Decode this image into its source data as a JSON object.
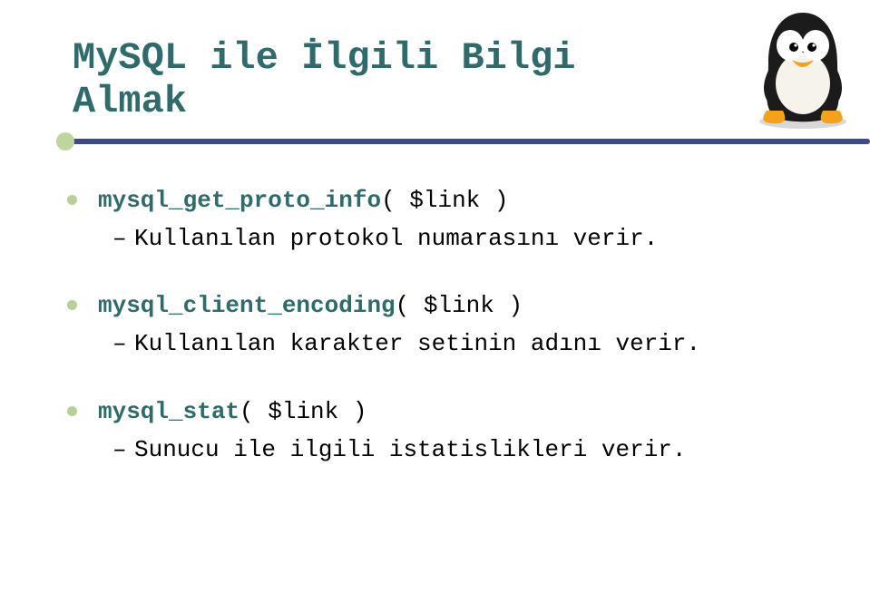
{
  "title_line1": "MySQL ile İlgili Bilgi",
  "title_line2": "Almak",
  "items": [
    {
      "func": "mysql_get_proto_info",
      "args": "( $link )",
      "desc": "Kullanılan protokol numarasını verir."
    },
    {
      "func": "mysql_client_encoding",
      "args": "( $link )",
      "desc": "Kullanılan karakter setinin adını verir."
    },
    {
      "func": "mysql_stat",
      "args": "( $link )",
      "desc": "Sunucu ile ilgili istatislikleri verir."
    }
  ]
}
